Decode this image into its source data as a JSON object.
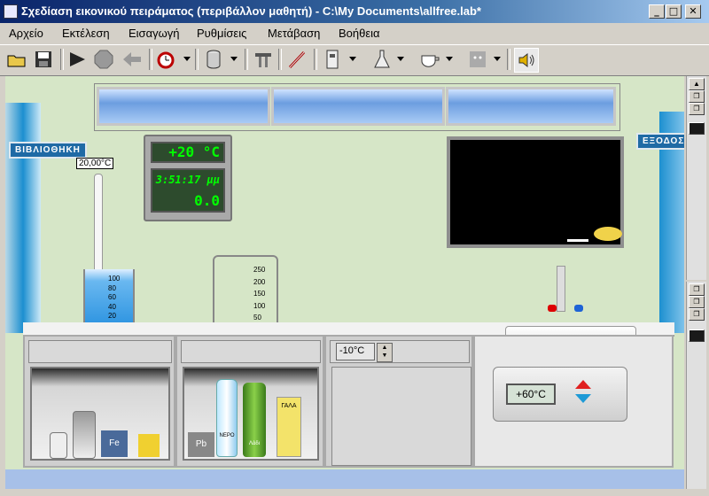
{
  "window": {
    "title": "Σχεδίαση εικονικού πειράματος (περιβάλλον μαθητή) - C:\\My Documents\\allfree.lab*"
  },
  "menu": [
    {
      "label": "Αρχείο"
    },
    {
      "label": "Εκτέλεση"
    },
    {
      "label": "Εισαγωγή"
    },
    {
      "label": "Ρυθμίσεις"
    },
    {
      "label": "Μετάβαση"
    },
    {
      "label": "Βοήθεια"
    }
  ],
  "toolbar": {
    "icons": [
      "open-folder-icon",
      "save-disk-icon",
      "play-icon",
      "stop-icon",
      "back-arrow-icon",
      "alarm-clock-icon",
      "cylinder-icon",
      "stand-icon",
      "pipette-icon",
      "meter-icon",
      "flask-icon",
      "cup-icon",
      "face-icon",
      "speaker-icon"
    ]
  },
  "lab": {
    "library_sign": "ΒΙΒΛΙΟΘΗΚΗ",
    "exit_sign": "ΕΞΟΔΟΣ",
    "thermometer_reading": "20,00°C",
    "clock": {
      "temperature": "+20 °C",
      "time": "3:51:17 μμ",
      "value": "0.0"
    },
    "beaker_scale": [
      "100",
      "80",
      "60",
      "40",
      "20"
    ],
    "cylinder_scale": [
      "250",
      "200",
      "150",
      "100",
      "50"
    ],
    "fridge_temp": "-10°C",
    "heater_temp": "+60°C",
    "shelf_labels": {
      "fe": "Fe",
      "pb": "Pb",
      "water": "ΝΕΡΟ",
      "oil": "Λάδι",
      "milk": "ΓΑΛΑ"
    }
  },
  "colors": {
    "wall": "#d6e6c7",
    "title_start": "#0a246a",
    "title_end": "#a6caf0",
    "sign": "#1f6aa5"
  }
}
